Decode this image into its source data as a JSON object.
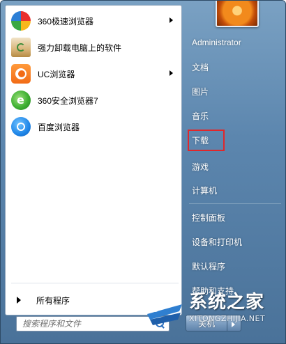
{
  "programs": [
    {
      "label": "360极速浏览器",
      "icon": "360-speed-browser-icon",
      "has_submenu": true
    },
    {
      "label": "强力卸载电脑上的软件",
      "icon": "uninstall-recycle-icon",
      "has_submenu": false
    },
    {
      "label": "UC浏览器",
      "icon": "uc-browser-icon",
      "has_submenu": true
    },
    {
      "label": "360安全浏览器7",
      "icon": "360-safe-browser-icon",
      "has_submenu": false
    },
    {
      "label": "百度浏览器",
      "icon": "baidu-browser-icon",
      "has_submenu": false
    }
  ],
  "all_programs_label": "所有程序",
  "search": {
    "placeholder": "搜索程序和文件"
  },
  "right_items": [
    {
      "label": "Administrator"
    },
    {
      "label": "文档"
    },
    {
      "label": "图片"
    },
    {
      "label": "音乐"
    },
    {
      "label": "下载"
    },
    {
      "label": "游戏"
    },
    {
      "label": "计算机"
    },
    {
      "label": "控制面板"
    },
    {
      "label": "设备和打印机"
    },
    {
      "label": "默认程序"
    },
    {
      "label": "帮助和支持"
    }
  ],
  "shutdown_label": "关机",
  "highlight_color": "#e0272b",
  "watermark": {
    "title": "系统之家",
    "url": "XITONGZHIJIA.NET"
  }
}
